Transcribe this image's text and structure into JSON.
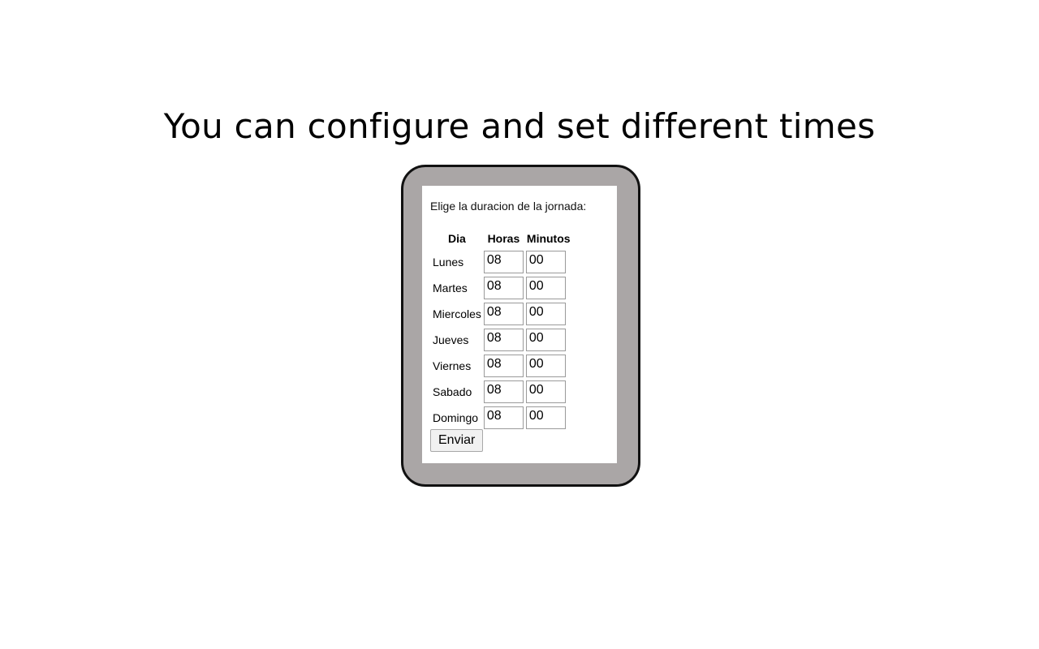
{
  "page": {
    "headline": "You can configure and set different times"
  },
  "form": {
    "prompt": "Elige la duracion de la jornada:",
    "headers": {
      "day": "Dia",
      "hours": "Horas",
      "minutes": "Minutos"
    },
    "rows": [
      {
        "day": "Lunes",
        "hours": "08",
        "minutes": "00"
      },
      {
        "day": "Martes",
        "hours": "08",
        "minutes": "00"
      },
      {
        "day": "Miercoles",
        "hours": "08",
        "minutes": "00"
      },
      {
        "day": "Jueves",
        "hours": "08",
        "minutes": "00"
      },
      {
        "day": "Viernes",
        "hours": "08",
        "minutes": "00"
      },
      {
        "day": "Sabado",
        "hours": "08",
        "minutes": "00"
      },
      {
        "day": "Domingo",
        "hours": "08",
        "minutes": "00"
      }
    ],
    "submit_label": "Enviar"
  },
  "colors": {
    "device_frame": "#aaa6a6",
    "device_border": "#111111",
    "screen_background": "#ffffff"
  }
}
